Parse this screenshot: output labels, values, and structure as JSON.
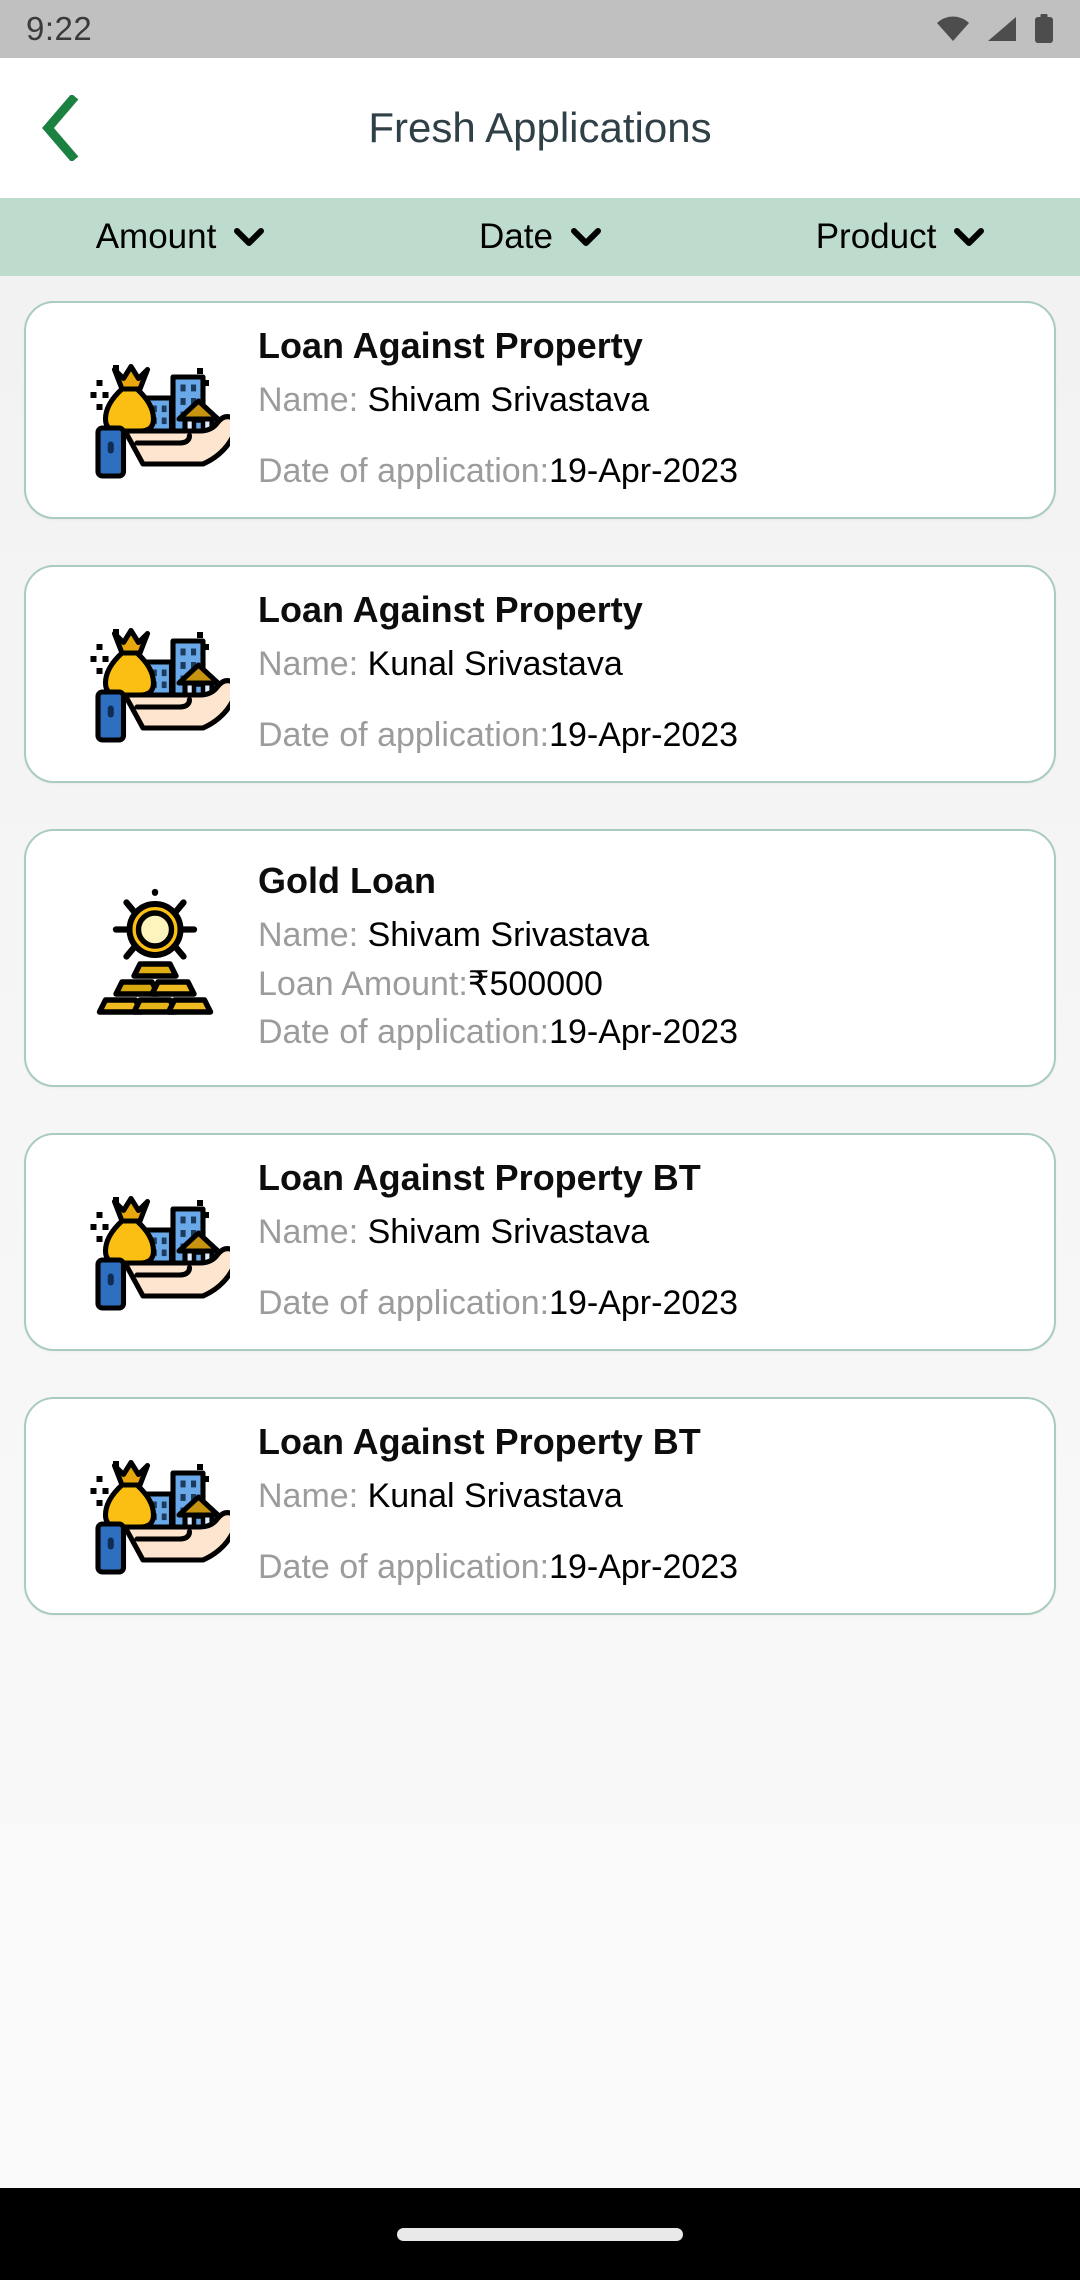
{
  "status_bar": {
    "time": "9:22",
    "icons": [
      "wifi-icon",
      "cellular-signal-icon",
      "battery-icon"
    ]
  },
  "app_bar": {
    "back_icon": "chevron-left-icon",
    "title": "Fresh Applications",
    "back_color": "#1b8140",
    "title_color": "#2f4047"
  },
  "filter_bar": {
    "background": "#bedccd",
    "filters": [
      {
        "label": "Amount",
        "icon": "chevron-down-icon"
      },
      {
        "label": "Date",
        "icon": "chevron-down-icon"
      },
      {
        "label": "Product",
        "icon": "chevron-down-icon"
      }
    ]
  },
  "labels": {
    "name": "Name:",
    "loan_amount": "Loan Amount:",
    "date_of_application": "Date of application:"
  },
  "cards": [
    {
      "icon": "property-loan-icon",
      "title": "Loan Against Property",
      "name": "Shivam Srivastava",
      "date": "19-Apr-2023"
    },
    {
      "icon": "property-loan-icon",
      "title": "Loan Against Property",
      "name": "Kunal Srivastava",
      "date": "19-Apr-2023"
    },
    {
      "icon": "gold-loan-icon",
      "title": "Gold Loan",
      "name": "Shivam Srivastava",
      "amount": "₹500000",
      "date": "19-Apr-2023"
    },
    {
      "icon": "property-loan-icon",
      "title": "Loan Against Property BT",
      "name": "Shivam Srivastava",
      "date": "19-Apr-2023"
    },
    {
      "icon": "property-loan-icon",
      "title": "Loan Against Property BT",
      "name": "Kunal Srivastava",
      "date": "19-Apr-2023"
    }
  ],
  "nav_bar": {
    "home_indicator": "home-indicator-pill"
  },
  "theme": {
    "card_border": "#a9ccbc",
    "card_background": "#ffffff",
    "page_background": "#f5f5f5",
    "label_gray": "#9c9c9c"
  }
}
